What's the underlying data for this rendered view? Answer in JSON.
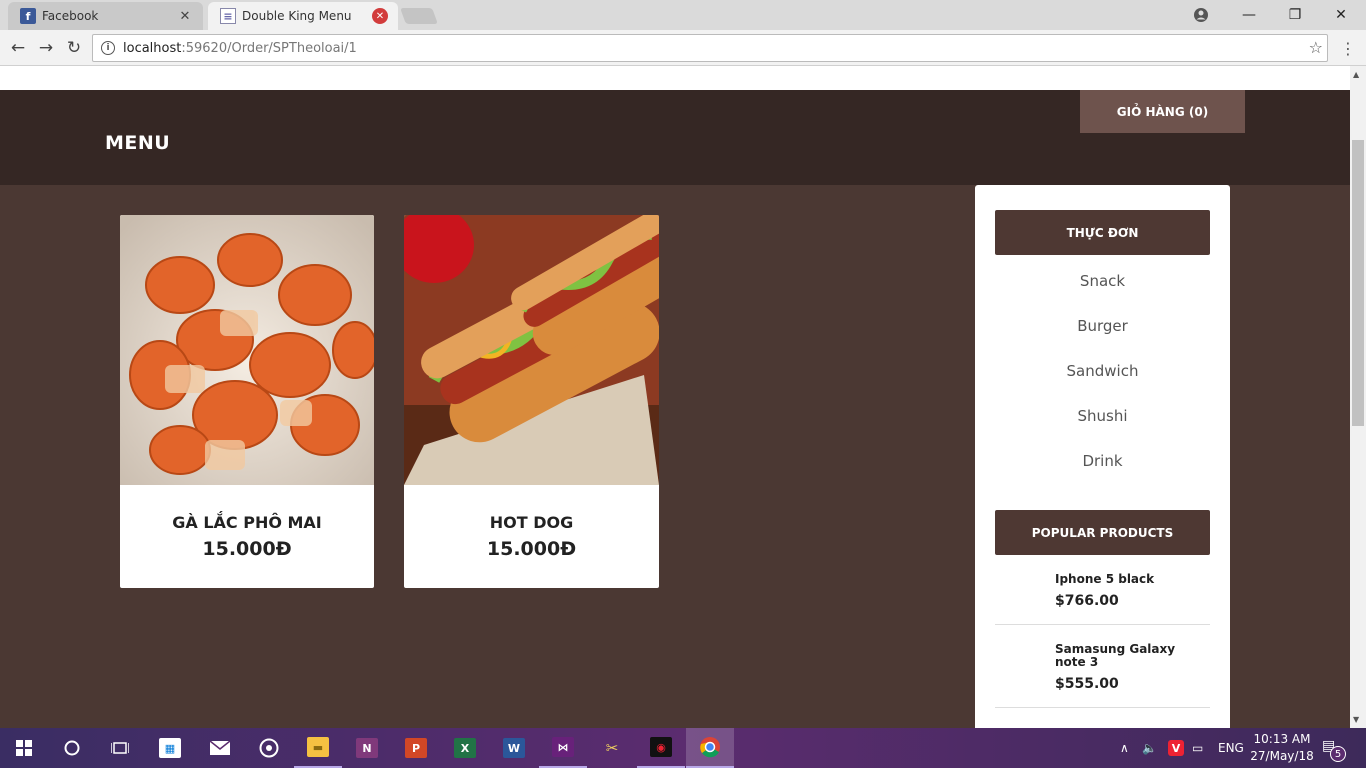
{
  "browser": {
    "tabs": [
      {
        "title": "Facebook",
        "favicon": "facebook-icon"
      },
      {
        "title": "Double King Menu",
        "favicon": "document-icon",
        "active": true
      }
    ],
    "url_host": "localhost",
    "url_path": ":59620/Order/SPTheoloai/1"
  },
  "site": {
    "brand": "MENU",
    "cart_label": "GIỎ HÀNG (0)"
  },
  "products": [
    {
      "name": "GÀ LẮC PHÔ MAI",
      "price": "15.000Đ"
    },
    {
      "name": "HOT DOG",
      "price": "15.000Đ"
    }
  ],
  "sidebar": {
    "menu_title": "THỰC ĐƠN",
    "categories": [
      "Snack",
      "Burger",
      "Sandwich",
      "Shushi",
      "Drink"
    ],
    "popular_title": "POPULAR PRODUCTS",
    "popular": [
      {
        "name": "Iphone 5 black",
        "price": "$766.00"
      },
      {
        "name": "Samasung Galaxy note 3",
        "price": "$555.00"
      }
    ]
  },
  "taskbar": {
    "language": "ENG",
    "time": "10:13 AM",
    "date": "27/May/18",
    "notification_count": "5"
  },
  "colors": {
    "header_dark": "#352724",
    "page_bg": "#4b3833",
    "cart_button": "#6e534d",
    "sidebar_header": "#4e3833"
  }
}
